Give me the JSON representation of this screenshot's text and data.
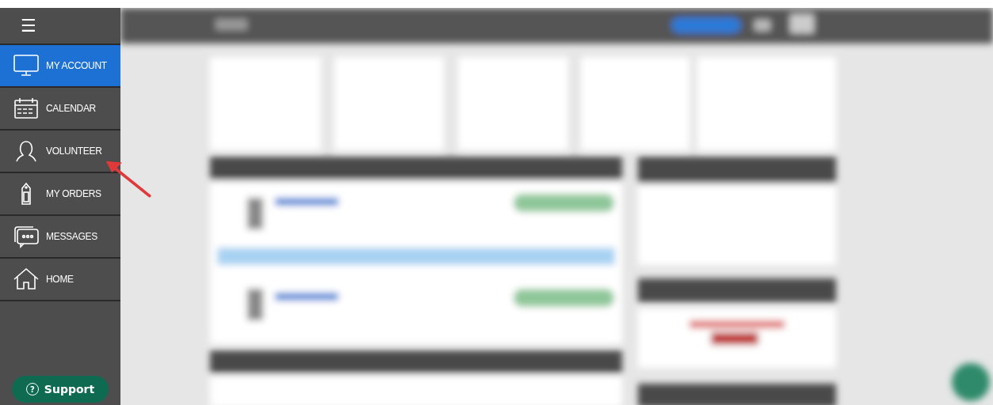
{
  "sidebar": {
    "menu_icon": "☰",
    "items": [
      {
        "label": "MY ACCOUNT",
        "kind": "monitor",
        "selected": true
      },
      {
        "label": "CALENDAR",
        "kind": "calendar",
        "selected": false
      },
      {
        "label": "VOLUNTEER",
        "kind": "person",
        "selected": false
      },
      {
        "label": "MY ORDERS",
        "kind": "tag",
        "selected": false
      },
      {
        "label": "MESSAGES",
        "kind": "chat",
        "selected": false
      },
      {
        "label": "HOME",
        "kind": "house",
        "selected": false
      }
    ],
    "support_button": {
      "icon": "?",
      "label": "Support"
    }
  }
}
